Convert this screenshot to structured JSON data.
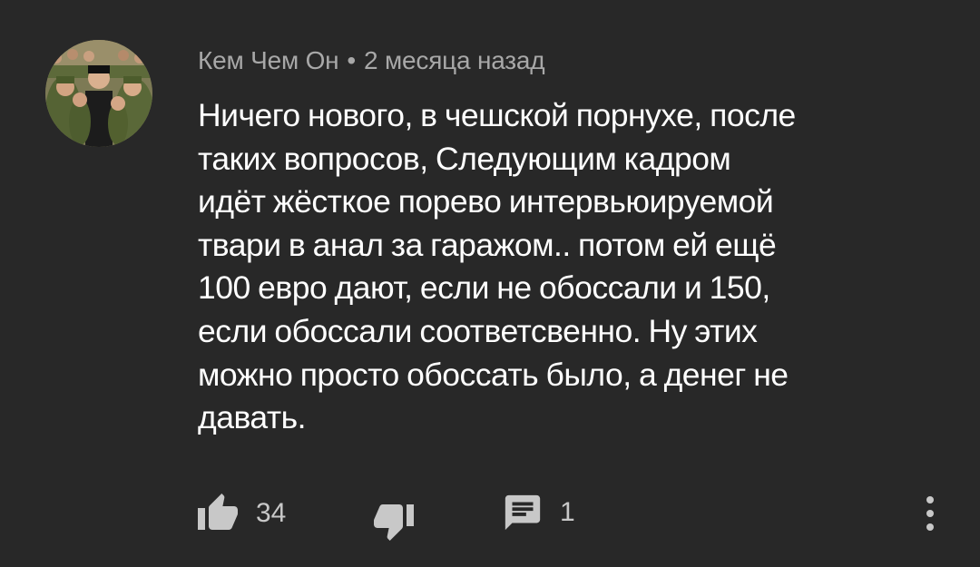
{
  "comment": {
    "author": "Кем Чем Он",
    "separator": "•",
    "time": "2 месяца назад",
    "text_lines": [
      "Ничего нового, в чешской порнухе, после",
      "таких вопросов, Следующим кадром",
      "идёт жёсткое порево интервьюируемой",
      "твари в анал за гаражом.. потом ей ещё",
      "100 евро дают, если не обоссали и 150,",
      "если обоссали соответсвенно. Ну этих",
      "можно просто обоссать было, а денег не",
      "давать."
    ]
  },
  "actions": {
    "like_count": "34",
    "reply_count": "1",
    "like_icon": "thumb-up-icon",
    "dislike_icon": "thumb-down-icon",
    "reply_icon": "reply-icon",
    "menu_icon": "more-vert-icon"
  },
  "colors": {
    "background": "#282828",
    "text": "#ffffff",
    "meta": "#a8a8a8",
    "icon": "#c8c8c8"
  }
}
